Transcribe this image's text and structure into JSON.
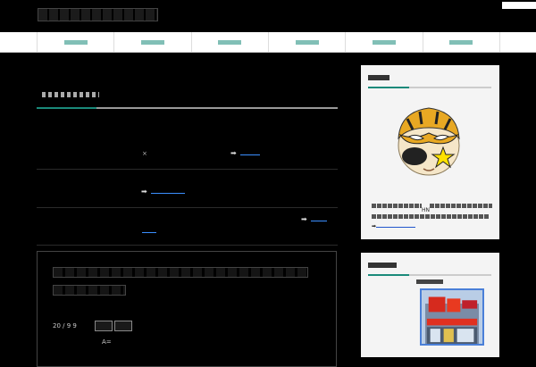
{
  "header": {
    "site_title": ""
  },
  "nav": {
    "tabs": [
      {
        "label": ""
      },
      {
        "label": ""
      },
      {
        "label": ""
      },
      {
        "label": ""
      },
      {
        "label": ""
      },
      {
        "label": ""
      }
    ]
  },
  "main": {
    "page_heading": "",
    "rows": [
      {
        "mark": "×",
        "arrow": "➡",
        "link": ""
      },
      {
        "arrow": "➡",
        "link": ""
      },
      {
        "arrow": "➡",
        "link": "",
        "link_cont": ""
      }
    ]
  },
  "post": {
    "title": "",
    "date": "20 / 9 9",
    "tags": [
      "",
      ""
    ],
    "author": "A=",
    "more_link": ""
  },
  "sidebar": {
    "profile": {
      "title": "",
      "avatar_icon": "tiger-mask-avatar-icon",
      "text_fragment": "HN",
      "arrow": "➡",
      "link": ""
    },
    "shop": {
      "title": "",
      "caption": "",
      "photo_icon": "shop-storefront-photo"
    }
  },
  "colors": {
    "accent": "#1a8a7a",
    "link": "#3b8fff",
    "background": "#000000",
    "sidebar": "#f4f4f4"
  }
}
